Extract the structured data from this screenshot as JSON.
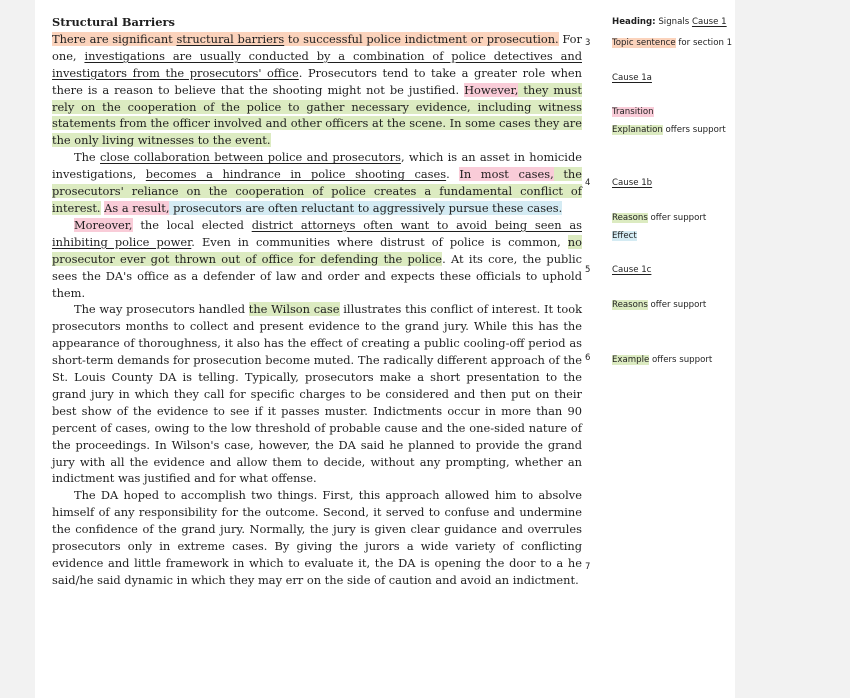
{
  "heading": "Structural Barriers",
  "p1": {
    "s1_a": "There are significant ",
    "s1_u": "structural barriers",
    "s1_b": " to successful police indictment or prosecution.",
    "s2_a": " For one, ",
    "s2_u": "investigations are usually conducted by a combination of police detectives and investigators from the prosecutors' office",
    "s2_b": ". Prosecutors tend to take a greater role when there is a reason to believe that the shooting might not be justified. ",
    "trans": "However,",
    "expl": " they must rely on the cooperation of the police to gather necessary evidence, including witness statements from the officer involved and other officers at the scene. In some cases they are the only living witnesses to the event."
  },
  "p2": {
    "a": "The ",
    "u1": "close collaboration between police and prosecutors",
    "b": ", which is an asset in homicide investigations, ",
    "u2": "becomes a hindrance in police shooting cases",
    "c": ". ",
    "pink1": "In most cases,",
    "green1": " the prosecutors' reliance on the cooperation of police creates a fundamental conflict of interest.",
    "d": " ",
    "pink2": "As a result,",
    "blue1": " prosecutors are often reluctant to aggressively pursue these cases."
  },
  "p3": {
    "pink1": "Moreover,",
    "a": " the local elected ",
    "u1": "district attorneys often want to avoid being seen as inhibiting police power",
    "b": ". Even in communities where distrust of police is common, ",
    "green1": "no prosecutor ever got thrown out of office for defending the police",
    "c": ". At its core, the public sees the DA's office as a defender of law and order and expects these officials to uphold them."
  },
  "p4": {
    "a": "The way prosecutors handled ",
    "green1": "the Wilson case",
    "b": " illustrates this conflict of interest. It took prosecutors months to collect and present evidence to the grand jury. While this has the appearance of thoroughness, it also has the effect of creating a public cooling-off period as short-term demands for prosecution become muted. The radically different approach of the St. Louis County DA is telling. Typically, prosecutors make a short presentation to the grand jury in which they call for specific charges to be considered and then put on their best show of the evidence to see if it passes muster. Indictments occur in more than 90 percent of cases, owing to the low threshold of probable cause and the one-sided nature of the proceedings. In Wilson's case, however, the DA said he planned to provide the grand jury with all the evidence and allow them to decide, without any prompting, whether an indictment was justified and for what offense."
  },
  "p5": {
    "a": "The DA hoped to accomplish two things. First, this approach allowed him to absolve himself of any responsibility for the outcome. Second, it served to confuse and undermine the confidence of the grand jury. Normally, the jury is given clear guidance and overrules prosecutors only in extreme cases. By giving the jurors a wide variety of conflicting evidence and little framework in which to evaluate it, the DA is opening the door to a he said/he said dynamic in which they may err on the side of caution and avoid an indictment."
  },
  "paragraph_numbers": [
    "3",
    "4",
    "5",
    "6",
    "7"
  ],
  "annotations": {
    "heading_bold": "Heading:",
    "heading_rest": " Signals ",
    "heading_cause": "Cause 1",
    "topic_hl": "Topic sentence",
    "topic_rest": " for section 1",
    "cause1a": "Cause 1a",
    "transition": "Transition",
    "expl_hl": "Explanation",
    "expl_rest": " offers support",
    "cause1b": "Cause 1b",
    "reasons1_hl": "Reasons",
    "reasons1_rest": " offer support",
    "effect": "Effect",
    "cause1c": "Cause 1c",
    "reasons2_hl": "Reasons",
    "reasons2_rest": " offer support",
    "example_hl": "Example",
    "example_rest": " offers support"
  },
  "colors": {
    "orange": "#fbd3bc",
    "pink": "#f9ccd8",
    "green": "#dcebc1",
    "blue": "#d4ebf3"
  }
}
